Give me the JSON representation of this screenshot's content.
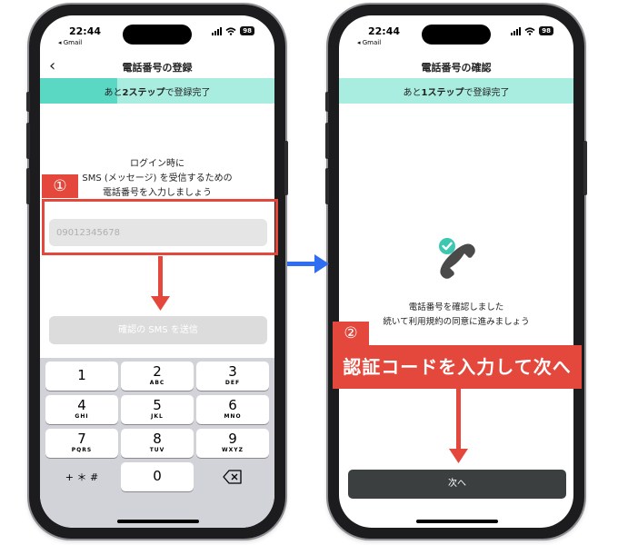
{
  "left_phone": {
    "status": {
      "time": "22:44",
      "back_app": "◂ Gmail",
      "battery": "98"
    },
    "nav": {
      "title": "電話番号の登録"
    },
    "progress": {
      "prefix": "あと",
      "count": "2",
      "unit": "ステップ",
      "suffix": "で登録完了",
      "fraction": 0.33
    },
    "message": {
      "line1": "ログイン時に",
      "line2": "SMS (メッセージ) を受信するための",
      "line3": "電話番号を入力しましょう"
    },
    "phone_input": {
      "placeholder": "09012345678"
    },
    "send_button": {
      "label": "確認の SMS を送信"
    },
    "keypad": {
      "keys": [
        {
          "digit": "1",
          "letters": ""
        },
        {
          "digit": "2",
          "letters": "ABC"
        },
        {
          "digit": "3",
          "letters": "DEF"
        },
        {
          "digit": "4",
          "letters": "GHI"
        },
        {
          "digit": "5",
          "letters": "JKL"
        },
        {
          "digit": "6",
          "letters": "MNO"
        },
        {
          "digit": "7",
          "letters": "PQRS"
        },
        {
          "digit": "8",
          "letters": "TUV"
        },
        {
          "digit": "9",
          "letters": "WXYZ"
        },
        {
          "digit": "0",
          "letters": ""
        }
      ],
      "symbols_label": "+ ＊ #"
    }
  },
  "right_phone": {
    "status": {
      "time": "22:44",
      "back_app": "◂ Gmail",
      "battery": "98"
    },
    "nav": {
      "title": "電話番号の確認"
    },
    "progress": {
      "prefix": "あと",
      "count": "1",
      "unit": "ステップ",
      "suffix": "で登録完了",
      "fraction": 0.0
    },
    "confirm": {
      "line1": "電話番号を確認しました",
      "line2": "続いて利用規約の同意に進みましょう"
    },
    "next_button": {
      "label": "次へ"
    }
  },
  "annotations": {
    "step1_badge": "①",
    "step2_badge": "②",
    "step2_banner": "認証コードを入力して次へ"
  },
  "colors": {
    "annotation_red": "#e4473c",
    "progress_light": "#a8ede0",
    "progress_dark": "#5ad8c4",
    "check_teal": "#3cc7b0",
    "arrow_blue": "#2f6ef2",
    "next_button": "#3b3f3f"
  },
  "icons": [
    "back-chevron-icon",
    "signal-icon",
    "wifi-icon",
    "battery-icon",
    "delete-key-icon",
    "phone-check-icon"
  ]
}
